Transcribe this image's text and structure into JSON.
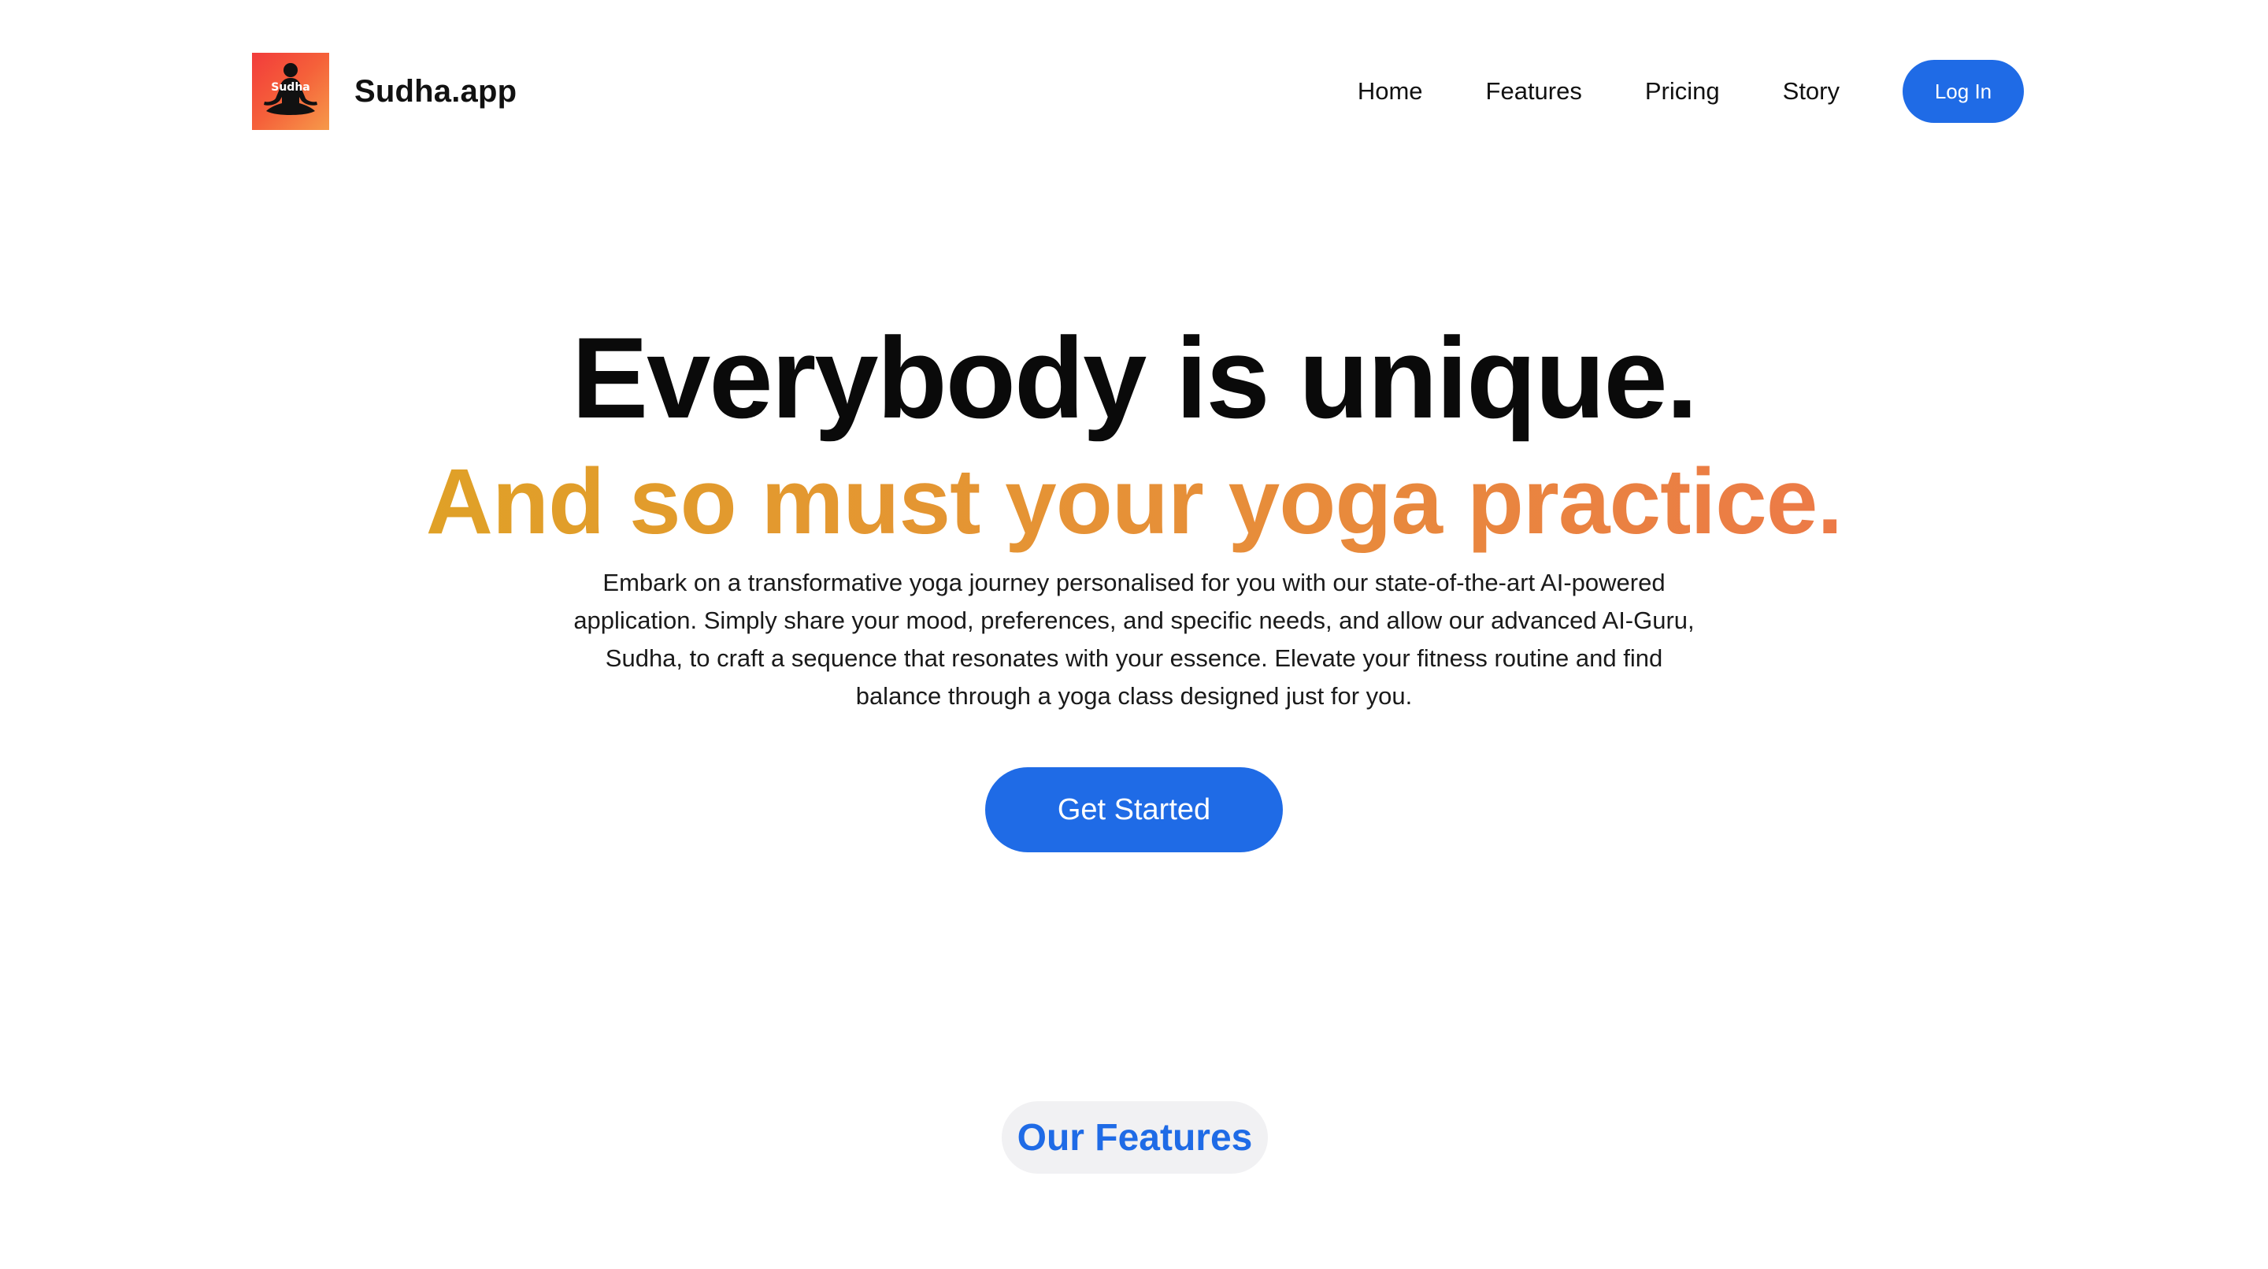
{
  "brand": {
    "name": "Sudha.app",
    "logo_text": "Sudha"
  },
  "nav": {
    "items": [
      {
        "label": "Home"
      },
      {
        "label": "Features"
      },
      {
        "label": "Pricing"
      },
      {
        "label": "Story"
      }
    ],
    "login_label": "Log In"
  },
  "hero": {
    "title": "Everybody is unique.",
    "subtitle": "And so must your yoga practice.",
    "description": "Embark on a transformative yoga journey personalised for you with our state-of-the-art AI-powered application. Simply share your mood, preferences, and specific needs, and allow our advanced AI-Guru, Sudha, to craft a sequence that resonates with your essence. Elevate your fitness routine and find balance through a yoga class designed just for you.",
    "cta_label": "Get Started"
  },
  "features": {
    "heading": "Our Features"
  },
  "colors": {
    "accent_blue": "#1f6be6",
    "gradient_start": "#e0a127",
    "gradient_end": "#ec7a47",
    "logo_gradient_start": "#f23b3b",
    "logo_gradient_end": "#f69a4a"
  }
}
